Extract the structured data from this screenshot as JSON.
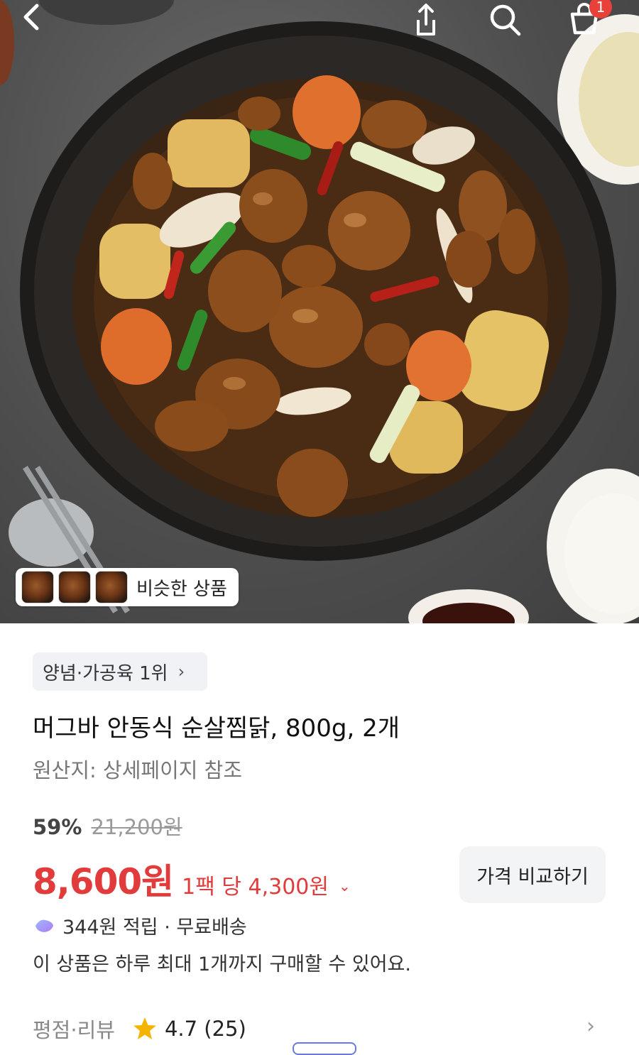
{
  "header": {
    "cart_badge": "1",
    "icons": [
      "chevron-left-icon",
      "share-icon",
      "search-icon",
      "cart-icon"
    ]
  },
  "hero": {
    "similar_products_label": "비슷한 상품"
  },
  "product": {
    "category_rank": "양념·가공육 1위",
    "category_chevron": "›",
    "title": "머그바 안동식 순살찜닭, 800g, 2개",
    "origin": "원산지: 상세페이지 참조",
    "discount_percent": "59%",
    "original_price": "21,200원",
    "price": "8,600원",
    "unit_price": "1팩 당 4,300원",
    "unit_price_chevron": "⌄",
    "compare_button": "가격 비교하기",
    "reward_text": "344원 적립 · 무료배송",
    "purchase_limit": "이 상품은 하루 최대 1개까지 구매할 수 있어요.",
    "rating_label": "평점·리뷰",
    "rating_score": "4.7 (25)",
    "rating_chevron": "›"
  },
  "colors": {
    "price_red": "#e23b3b",
    "badge_red": "#e8413a",
    "star_yellow": "#f5b400",
    "chip_gray": "#f1f2f5"
  }
}
